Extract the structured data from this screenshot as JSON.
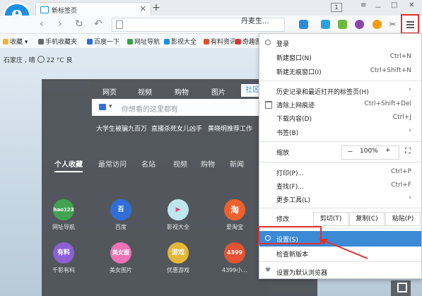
{
  "tab": {
    "title": "新标签页",
    "close": "✕"
  },
  "newtab": "+",
  "window": {
    "page_count": "1",
    "icons": [
      "≡",
      "－",
      "□",
      "✕"
    ]
  },
  "nav": {
    "back": "‹",
    "forward": "›",
    "refresh": "↻",
    "undo": "↶",
    "search_text": "丹麦生..."
  },
  "bookmarks": [
    {
      "label": "收藏",
      "color": "#f2b233"
    },
    {
      "label": "手机收藏夹",
      "color": "#666666"
    },
    {
      "label": "百度一下",
      "color": "#2a6ad8"
    },
    {
      "label": "网址导航",
      "color": "#3aa14a"
    },
    {
      "label": "影视大全",
      "color": "#1c8ee6"
    },
    {
      "label": "有料资讯",
      "color": "#e44e2c"
    },
    {
      "label": "奇趣图",
      "color": "#d33"
    }
  ],
  "weather": {
    "city": "石家庄 , 晴",
    "temp": "22 °C 良"
  },
  "search": {
    "tabs": [
      "网页",
      "视频",
      "购物",
      "图片",
      "社区"
    ],
    "placeholder": "你想看的这里都有",
    "dropdown": "▾",
    "hot": [
      "大学生被骗九百万",
      "直播杀死女儿凶手",
      "黄晓明推荐工作"
    ]
  },
  "content_tabs": [
    "个人收藏",
    "最常访问",
    "名站",
    "视频",
    "购物",
    "新闻"
  ],
  "tiles": [
    {
      "label": "网址导航",
      "icon": "hao123",
      "color": "#3aa14a"
    },
    {
      "label": "百度",
      "icon": "百",
      "color": "#2a6ad8"
    },
    {
      "label": "影视大全",
      "icon": "▶",
      "color": "#bfe6ee"
    },
    {
      "label": "爱淘宝",
      "icon": "淘",
      "color": "#f15a24"
    },
    {
      "label": "千影有料",
      "icon": "有料",
      "color": "#8a5ad8"
    },
    {
      "label": "美女图片",
      "icon": "美女图",
      "color": "#f06fb4"
    },
    {
      "label": "优惠游戏",
      "icon": "游戏",
      "color": "#e8b631"
    },
    {
      "label": "4399小...",
      "icon": "4399",
      "color": "#e84d2b"
    }
  ],
  "menu": {
    "login": "登录",
    "new_window": {
      "label": "新建窗口(N)",
      "shortcut": "Ctrl+N"
    },
    "new_incognito": {
      "label": "新建无痕窗口(I)",
      "shortcut": "Ctrl+Shift+N"
    },
    "history": {
      "label": "历史记录和最近打开的标签页(H)",
      "arrow": "›"
    },
    "clear": {
      "label": "清除上网痕迹",
      "shortcut": "Ctrl+Shift+Del"
    },
    "downloads": {
      "label": "下载内容(D)",
      "shortcut": "Ctrl+J"
    },
    "bookmarks": {
      "label": "书签(B)",
      "arrow": "›"
    },
    "zoom": {
      "label": "缩放",
      "minus": "－",
      "value": "100%",
      "plus": "+",
      "fullscreen": "⛶"
    },
    "print": {
      "label": "打印(P)...",
      "shortcut": "Ctrl+P"
    },
    "find": {
      "label": "查找(F)...",
      "shortcut": "Ctrl+F"
    },
    "more_tools": {
      "label": "更多工具(L)",
      "arrow": "›"
    },
    "edit": {
      "label": "修改",
      "cut": "剪切(T)",
      "copy": "复制(C)",
      "paste": "粘贴(P)"
    },
    "settings": {
      "label": "设置(S)"
    },
    "check_version": {
      "label": "检查新版本"
    },
    "default_browser": {
      "label": "设置为默认浏览器"
    }
  },
  "colors": {
    "accent": "#3c8ad6",
    "annotation": "#e0312f"
  }
}
